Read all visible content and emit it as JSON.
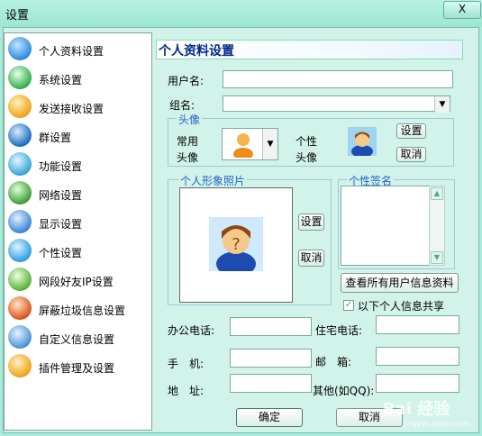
{
  "window": {
    "title": "设置",
    "close_label": "X"
  },
  "sidebar": {
    "items": [
      {
        "label": "个人资料设置",
        "icon": "person-globe-icon",
        "color": "#2f8ae0"
      },
      {
        "label": "系统设置",
        "icon": "system-gear-icon",
        "color": "#32b04a"
      },
      {
        "label": "发送接收设置",
        "icon": "send-receive-icon",
        "color": "#f0a31c"
      },
      {
        "label": "群设置",
        "icon": "globe-group-icon",
        "color": "#1c6fc0"
      },
      {
        "label": "功能设置",
        "icon": "function-icon",
        "color": "#39a6d6"
      },
      {
        "label": "网络设置",
        "icon": "network-icon",
        "color": "#3f9f3a"
      },
      {
        "label": "显示设置",
        "icon": "display-icon",
        "color": "#3b86d8"
      },
      {
        "label": "个性设置",
        "icon": "personality-icon",
        "color": "#2f9fe0"
      },
      {
        "label": "网段好友IP设置",
        "icon": "ip-segment-icon",
        "color": "#5ab33c"
      },
      {
        "label": "屏蔽垃圾信息设置",
        "icon": "block-spam-icon",
        "color": "#e0541c"
      },
      {
        "label": "自定义信息设置",
        "icon": "custom-info-icon",
        "color": "#4a93d6"
      },
      {
        "label": "插件管理及设置",
        "icon": "plugin-icon",
        "color": "#f0a21c"
      }
    ]
  },
  "main": {
    "header": "个人资料设置",
    "username_label": "用户名:",
    "username_value": "",
    "group_label": "组名:",
    "group_value": "",
    "avatar_group": {
      "title": "头像",
      "common_label_1": "常用",
      "common_label_2": "头像",
      "personal_label_1": "个性",
      "personal_label_2": "头像",
      "set_button": "设置",
      "cancel_button": "取消"
    },
    "photo_group": {
      "title": "个人形象照片",
      "set_button": "设置",
      "cancel_button": "取消"
    },
    "signature_group": {
      "title": "个性签名",
      "value": ""
    },
    "view_all_button": "查看所有用户信息资料",
    "share_checkbox": {
      "label": "以下个人信息共享",
      "checked": true
    },
    "office_phone_label": "办公电话:",
    "office_phone_value": "",
    "home_phone_label": "住宅电话:",
    "home_phone_value": "",
    "mobile_label": "手　机:",
    "mobile_value": "",
    "email_label": "邮　箱:",
    "email_value": "",
    "address_label": "地　址:",
    "address_value": "",
    "other_label": "其他(如QQ):",
    "other_value": "",
    "ok_button": "确定",
    "cancel_button": "取消"
  },
  "watermark": {
    "text": "Bai 经验",
    "sub": "jingyan.baidu.com"
  }
}
